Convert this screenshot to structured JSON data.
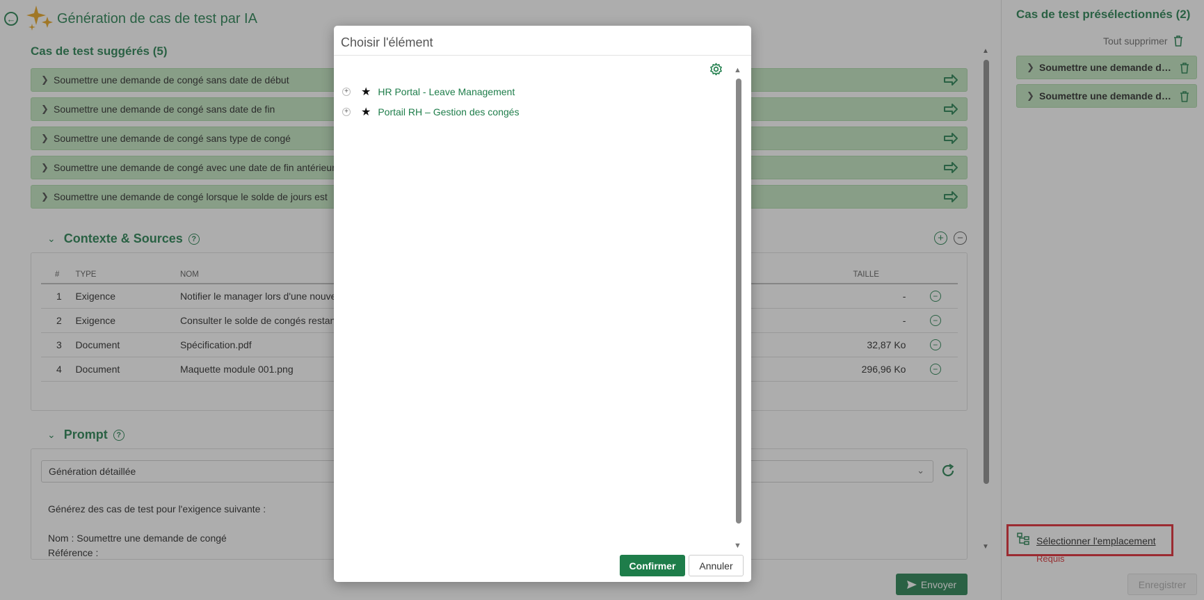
{
  "header": {
    "title": "Génération de cas de test par IA"
  },
  "suggested": {
    "title": "Cas de test suggérés (5)",
    "items": [
      {
        "label": "Soumettre une demande de congé sans date de début"
      },
      {
        "label": "Soumettre une demande de congé sans date de fin"
      },
      {
        "label": "Soumettre une demande de congé sans type de congé"
      },
      {
        "label": "Soumettre une demande de congé avec une date de fin antérieure"
      },
      {
        "label": "Soumettre une demande de congé lorsque le solde de jours est"
      }
    ]
  },
  "context": {
    "title": "Contexte & Sources",
    "help": "?",
    "columns": {
      "num": "#",
      "type": "TYPE",
      "name": "NOM",
      "size": "TAILLE"
    },
    "rows": [
      {
        "num": "1",
        "type": "Exigence",
        "name": "Notifier le manager lors d'une nouvel",
        "size": "-"
      },
      {
        "num": "2",
        "type": "Exigence",
        "name": "Consulter le solde de congés restant",
        "size": "-"
      },
      {
        "num": "3",
        "type": "Document",
        "name": "Spécification.pdf",
        "size": "32,87 Ko"
      },
      {
        "num": "4",
        "type": "Document",
        "name": "Maquette module 001.png",
        "size": "296,96 Ko"
      }
    ]
  },
  "prompt": {
    "title": "Prompt",
    "help": "?",
    "selected": "Génération détaillée",
    "line1": "Générez des cas de test pour l'exigence suivante :",
    "line2": "Nom : Soumettre une demande de congé",
    "line3": "Référence :"
  },
  "footer": {
    "send_label": "Envoyer"
  },
  "right_panel": {
    "title": "Cas de test présélectionnés (2)",
    "delete_all": "Tout supprimer",
    "items": [
      {
        "label": "Soumettre une demande de congé sans date de début"
      },
      {
        "label": "Soumettre une demande de congé sans date de fin"
      }
    ],
    "location_link": "Sélectionner l'emplacement",
    "required": "Requis",
    "save_label": "Enregistrer"
  },
  "modal": {
    "title": "Choisir l'élément",
    "tree": [
      {
        "label": "HR Portal - Leave Management"
      },
      {
        "label": "Portail RH – Gestion des congés"
      }
    ],
    "confirm": "Confirmer",
    "cancel": "Annuler"
  },
  "colors": {
    "accent": "#1e7d4a",
    "item_bg": "#bfe5bd",
    "required": "#d9262b",
    "highlight": "#e0202a"
  }
}
